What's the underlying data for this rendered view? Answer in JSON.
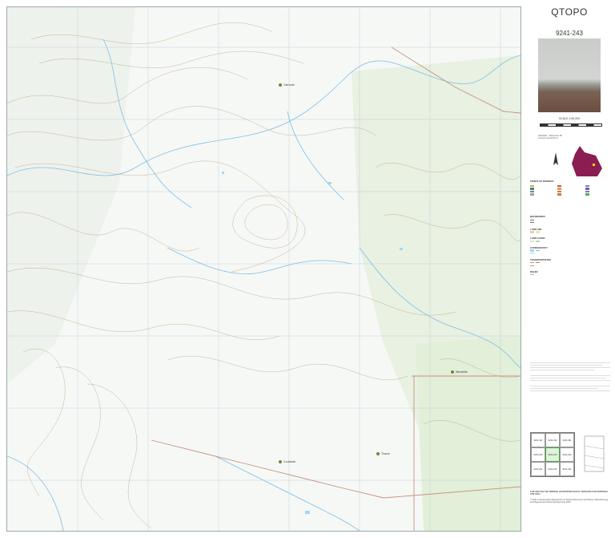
{
  "map": {
    "place_labels": [
      "Glenvale",
      "Wirrabilla",
      "Tinana",
      "Coolabah"
    ],
    "colors": {
      "water": "#8fc8e8",
      "contour": "#b9a98a",
      "road": "#c08a7a",
      "veg": "#e3efdb",
      "background": "#f6f8f6"
    }
  },
  "panel": {
    "title": "QTOPO",
    "sheet_number": "9241-243",
    "scale": "SCALE 1:50,000",
    "legend_heading": "POINTS OF INTEREST",
    "sections": [
      "BOUNDARIES",
      "LAND USE",
      "LAND COVER",
      "HYDROGRAPHY",
      "TRANSPORTATION",
      "RELIEF"
    ],
    "copyright": "© State of Queensland (Department of Natural Resources and Mines, Manufacturing and Regional and Rural Development) 2025",
    "notice": "THIS MAP MAY BE PRINTED OR REPRODUCED BY PERSONS FOR PERSONAL USE ONLY"
  },
  "index_sheets": [
    "9241-411",
    "9241-244",
    "9241-331",
    "9241-242",
    "9241-243",
    "9241-334",
    "9241-241",
    "9241-224",
    "9241-311"
  ]
}
